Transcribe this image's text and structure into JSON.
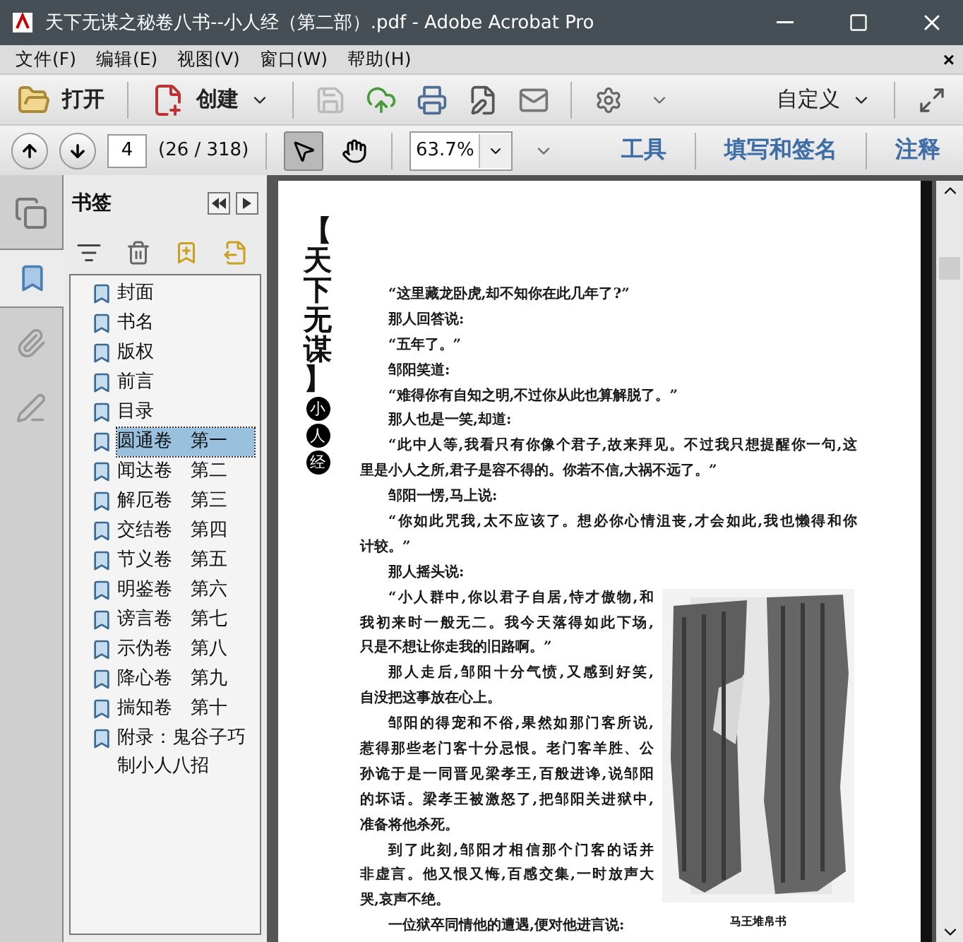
{
  "window": {
    "title": "天下无谋之秘卷八书--小人经（第二部）.pdf - Adobe Acrobat Pro"
  },
  "menu": {
    "items": [
      "文件(F)",
      "编辑(E)",
      "视图(V)",
      "窗口(W)",
      "帮助(H)"
    ],
    "close": "×"
  },
  "toolbar": {
    "open": "打开",
    "create": "创建",
    "customize": "自定义",
    "save_disabled": true
  },
  "navbar": {
    "page": "4",
    "page_count": "(26 / 318)",
    "zoom": "63.7%",
    "tools": [
      {
        "kind": "select",
        "selected": true
      },
      {
        "kind": "hand",
        "selected": false
      }
    ],
    "panes": [
      "工具",
      "填写和签名",
      "注释"
    ]
  },
  "sidebar": {
    "title": "书签",
    "tabs": [
      {
        "kind": "bookmarks",
        "selected": true
      },
      {
        "kind": "attachments",
        "selected": false
      },
      {
        "kind": "signatures",
        "selected": false
      }
    ],
    "bookmarks": [
      {
        "label": "封面",
        "selected": false
      },
      {
        "label": "书名",
        "selected": false
      },
      {
        "label": "版权",
        "selected": false
      },
      {
        "label": "前言",
        "selected": false
      },
      {
        "label": "目录",
        "selected": false
      },
      {
        "label": "圆通卷　第一",
        "selected": true
      },
      {
        "label": "闻达卷　第二",
        "selected": false
      },
      {
        "label": "解厄卷　第三",
        "selected": false
      },
      {
        "label": "交结卷　第四",
        "selected": false
      },
      {
        "label": "节义卷　第五",
        "selected": false
      },
      {
        "label": "明鉴卷　第六",
        "selected": false
      },
      {
        "label": "谤言卷　第七",
        "selected": false
      },
      {
        "label": "示伪卷　第八",
        "selected": false
      },
      {
        "label": "降心卷　第九",
        "selected": false
      },
      {
        "label": "揣知卷　第十",
        "selected": false
      },
      {
        "label": "附录：鬼谷子巧制小人八招",
        "selected": false
      }
    ]
  },
  "page": {
    "title": "【天下无谋】",
    "series": [
      "小",
      "人",
      "经"
    ],
    "text_above": [
      [
        "“这里藏龙卧虎,却不知你在此几年了?”"
      ],
      [
        "那人回答说:"
      ],
      [
        "“五年了。”"
      ],
      [
        "邹阳笑道:"
      ],
      [
        "“难得你有自知之明,不过你从此也算解脱了。”"
      ],
      [
        "那人也是一笑,却道:"
      ],
      [
        "“此中人等,我看只有你像个君子,故来拜见。不过我只想提醒你一句,这",
        "里是小人之所,君子是容不得的。你若不信,大祸不远了。”"
      ],
      [
        "邹阳一愣,马上说:"
      ],
      [
        "“你如此咒我,太不应该了。想必你心情沮丧,才会如此,我也懒得和你",
        "计较。”"
      ],
      [
        "那人摇头说:"
      ]
    ],
    "text_beside_figure": [
      [
        "“小人群中,你以君子自居,恃才傲物,和",
        "我初来时一般无二。我今天落得如此下场,",
        "只是不想让你走我的旧路啊。”"
      ],
      [
        "那人走后,邹阳十分气愤,又感到好笑,",
        "自没把这事放在心上。"
      ],
      [
        "邹阳的得宠和不俗,果然如那门客所说,",
        "惹得那些老门客十分忌恨。老门客羊胜、公",
        "孙诡于是一同晋见梁孝王,百般进谗,说邹阳",
        "的坏话。梁孝王被激怒了,把邹阳关进狱中,",
        "准备将他杀死。"
      ],
      [
        "到了此刻,邹阳才相信那个门客的话并",
        "非虚言。他又恨又悔,百感交集,一时放声大",
        "哭,哀声不绝。"
      ],
      [
        "一位狱卒同情他的遭遇,便对他进言说:"
      ]
    ],
    "figure": {
      "kind": "picture",
      "caption": "马王堆帛书"
    }
  }
}
